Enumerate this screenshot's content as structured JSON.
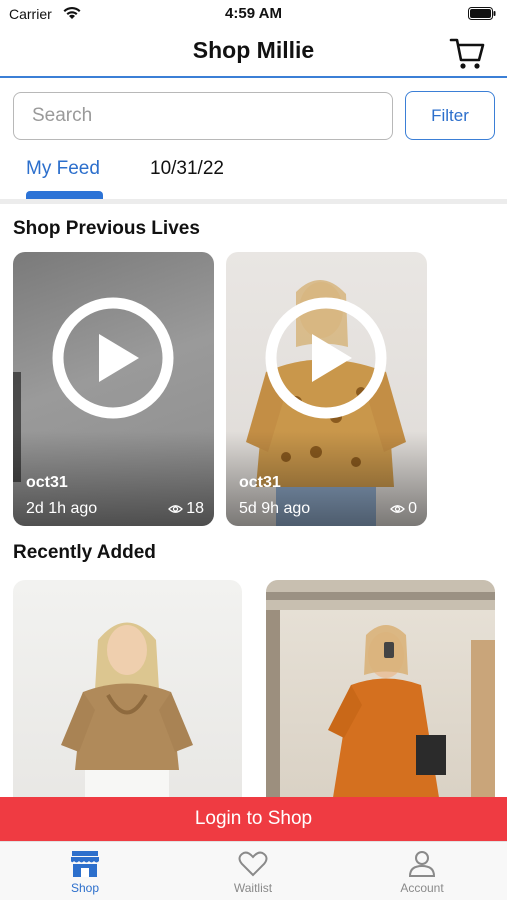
{
  "status": {
    "carrier": "Carrier",
    "time": "4:59 AM"
  },
  "nav": {
    "title": "Shop Millie"
  },
  "search": {
    "placeholder": "Search",
    "filter_label": "Filter"
  },
  "tabs": [
    {
      "label": "My Feed",
      "active": true
    },
    {
      "label": "10/31/22",
      "active": false
    }
  ],
  "sections": {
    "previous_lives": "Shop Previous Lives",
    "recently_added": "Recently Added"
  },
  "lives": [
    {
      "name": "oct31",
      "ago": "2d 1h ago",
      "views": "18"
    },
    {
      "name": "oct31",
      "ago": "5d 9h ago",
      "views": "0"
    }
  ],
  "login_banner": "Login to Shop",
  "tab_bar": [
    {
      "label": "Shop",
      "icon": "storefront-icon",
      "active": true
    },
    {
      "label": "Waitlist",
      "icon": "heart-icon",
      "active": false
    },
    {
      "label": "Account",
      "icon": "person-icon",
      "active": false
    }
  ],
  "colors": {
    "accent": "#2c6fcc",
    "banner": "#ef3b42"
  }
}
